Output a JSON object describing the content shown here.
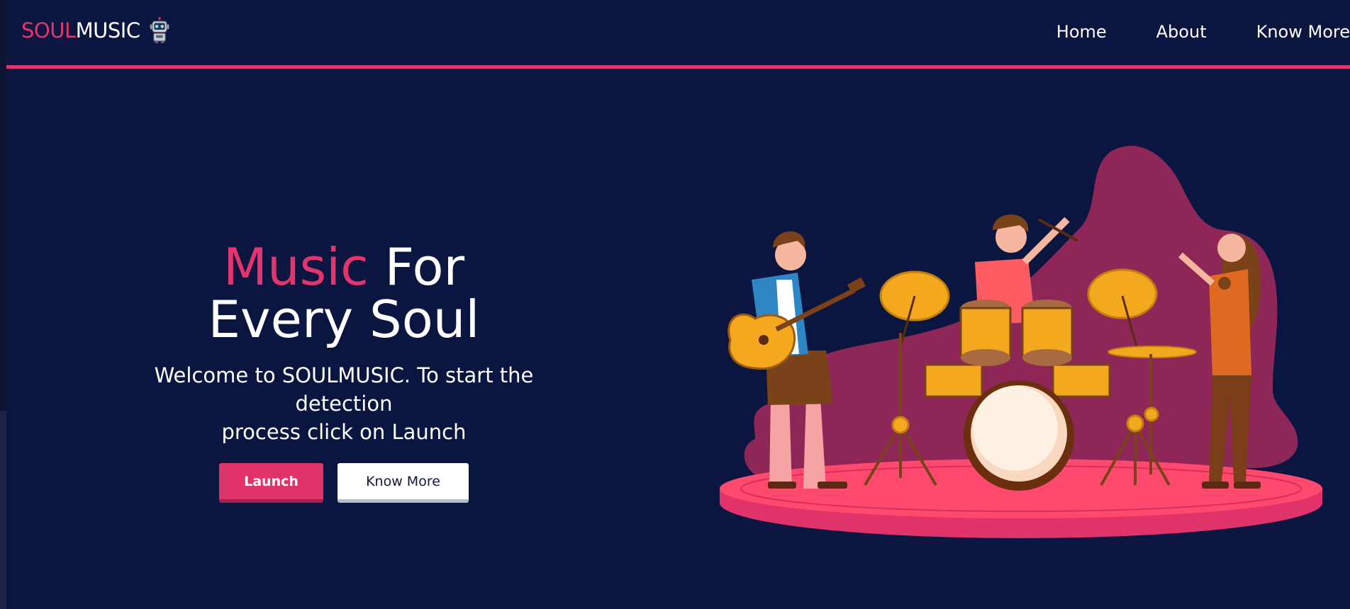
{
  "brand": {
    "accent": "SOUL",
    "rest": "MUSIC",
    "icon": "robot-icon"
  },
  "nav": {
    "items": [
      {
        "label": "Home"
      },
      {
        "label": "About"
      },
      {
        "label": "Know More"
      }
    ]
  },
  "hero": {
    "title_accent": "Music",
    "title_rest": " For",
    "title_line2": "Every Soul",
    "subtitle_line1": "Welcome to SOULMUSIC. To start the detection",
    "subtitle_line2": "process click on Launch",
    "launch_label": "Launch",
    "know_more_label": "Know More"
  },
  "illustration": {
    "subject": "band-illustration"
  },
  "colors": {
    "background": "#0b1640",
    "accent": "#e4346d",
    "text": "#ffffff"
  }
}
